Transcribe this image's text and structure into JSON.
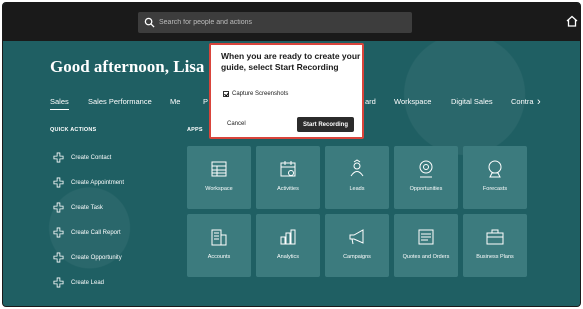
{
  "topbar": {
    "search_placeholder": "Search for people and actions",
    "search_icon": "search-icon",
    "home_icon": "home-icon"
  },
  "greeting": "Good afternoon, Lisa Jo",
  "tabs": [
    {
      "label": "Sales",
      "active": true
    },
    {
      "label": "Sales Performance"
    },
    {
      "label": "Me"
    },
    {
      "label": "P"
    },
    {
      "label": "ard"
    },
    {
      "label": "Workspace"
    },
    {
      "label": "Digital Sales"
    },
    {
      "label": "Contra"
    }
  ],
  "quick_actions": {
    "title": "QUICK ACTIONS",
    "items": [
      {
        "label": "Create Contact"
      },
      {
        "label": "Create Appointment"
      },
      {
        "label": "Create Task"
      },
      {
        "label": "Create Call Report"
      },
      {
        "label": "Create Opportunity"
      },
      {
        "label": "Create Lead"
      }
    ]
  },
  "apps": {
    "title": "APPS",
    "tiles": [
      {
        "label": "Workspace",
        "icon": "workspace-icon"
      },
      {
        "label": "Activities",
        "icon": "calendar-icon"
      },
      {
        "label": "Leads",
        "icon": "leads-icon"
      },
      {
        "label": "Opportunities",
        "icon": "opportunities-icon"
      },
      {
        "label": "Forecasts",
        "icon": "crystal-ball-icon"
      },
      {
        "label": "Accounts",
        "icon": "building-icon"
      },
      {
        "label": "Analytics",
        "icon": "analytics-icon"
      },
      {
        "label": "Campaigns",
        "icon": "megaphone-icon"
      },
      {
        "label": "Quotes and Orders",
        "icon": "quotes-icon"
      },
      {
        "label": "Business Plans",
        "icon": "briefcase-icon"
      }
    ]
  },
  "dialog": {
    "title": "When you are ready to create your guide, select Start Recording",
    "checkbox_label": "Capture Screenshots",
    "checkbox_checked": true,
    "cancel_label": "Cancel",
    "start_label": "Start Recording",
    "highlight_color": "#d9443b"
  },
  "colors": {
    "background": "#1f5f63",
    "tile": "#3c7b7e",
    "topbar": "#1a1a1a"
  }
}
